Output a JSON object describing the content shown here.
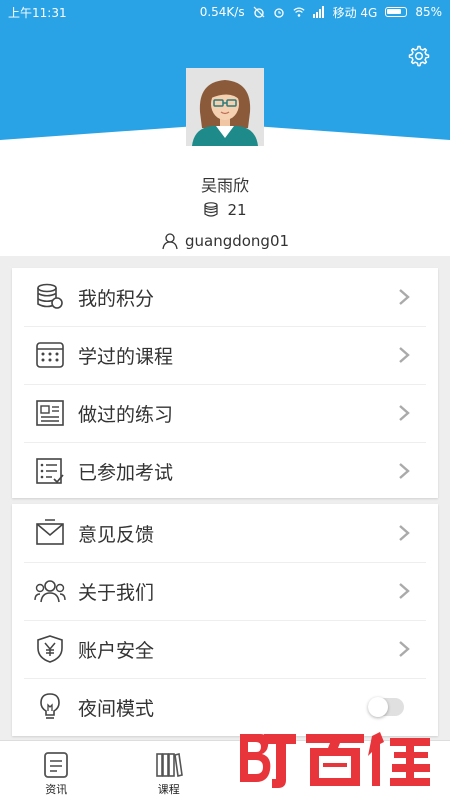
{
  "status_bar": {
    "time": "上午11:31",
    "speed": "0.54K/s",
    "carrier": "移动 4G",
    "battery": "85%"
  },
  "colors": {
    "header_blue": "#29a3e6",
    "watermark_red": "#e8343b"
  },
  "profile": {
    "name": "吴雨欣",
    "points": "21",
    "account": "guangdong01"
  },
  "menu_group1": [
    {
      "label": "我的积分",
      "icon": "coins-icon"
    },
    {
      "label": "学过的课程",
      "icon": "calendar-icon"
    },
    {
      "label": "做过的练习",
      "icon": "document-icon"
    },
    {
      "label": "已参加考试",
      "icon": "checklist-icon"
    }
  ],
  "menu_group2": [
    {
      "label": "意见反馈",
      "icon": "envelope-icon"
    },
    {
      "label": "关于我们",
      "icon": "people-icon"
    },
    {
      "label": "账户安全",
      "icon": "shield-yen-icon"
    },
    {
      "label": "夜间模式",
      "icon": "lightbulb-icon",
      "toggle": false
    }
  ],
  "tabs": [
    {
      "label": "资讯",
      "icon": "news-icon"
    },
    {
      "label": "课程",
      "icon": "books-icon"
    }
  ],
  "watermark": "百佳"
}
